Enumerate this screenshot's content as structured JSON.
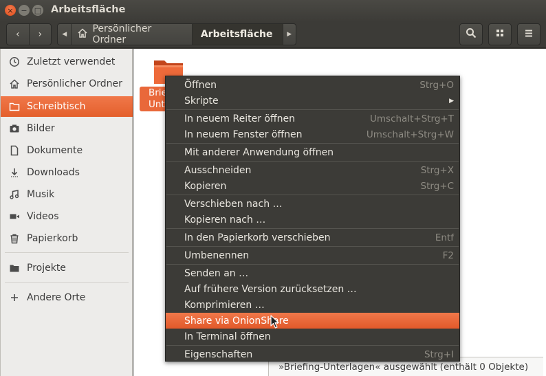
{
  "window": {
    "title": "Arbeitsfläche",
    "close_glyph": "×",
    "min_glyph": "−",
    "max_glyph": "□"
  },
  "toolbar": {
    "back_glyph": "‹",
    "forward_glyph": "›",
    "path_left_glyph": "◀",
    "path_right_glyph": "▶",
    "path": [
      {
        "label": "Persönlicher Ordner",
        "icon": "home-icon"
      },
      {
        "label": "Arbeitsfläche",
        "active": true
      }
    ]
  },
  "sidebar": {
    "items": [
      {
        "label": "Zuletzt verwendet",
        "icon": "clock-icon"
      },
      {
        "label": "Persönlicher Ordner",
        "icon": "home-icon"
      },
      {
        "label": "Schreibtisch",
        "icon": "folder-icon",
        "active": true
      },
      {
        "label": "Bilder",
        "icon": "camera-icon"
      },
      {
        "label": "Dokumente",
        "icon": "document-icon"
      },
      {
        "label": "Downloads",
        "icon": "download-icon"
      },
      {
        "label": "Musik",
        "icon": "music-icon"
      },
      {
        "label": "Videos",
        "icon": "video-icon"
      },
      {
        "label": "Papierkorb",
        "icon": "trash-icon"
      },
      {
        "label": "Projekte",
        "icon": "folder-icon"
      },
      {
        "label": "Andere Orte",
        "icon": "plus-icon"
      }
    ]
  },
  "main": {
    "file_label_line1": "Brief",
    "file_label_line2": "Unte",
    "status": "»Briefing-Unterlagen« ausgewählt  (enthält 0 Objekte)"
  },
  "context_menu": {
    "items": [
      {
        "label": "Öffnen",
        "accel": "Strg+O"
      },
      {
        "label": "Skripte",
        "submenu_glyph": "▶"
      },
      {
        "label": "In neuem Reiter öffnen",
        "accel": "Umschalt+Strg+T"
      },
      {
        "label": "In neuem Fenster öffnen",
        "accel": "Umschalt+Strg+W"
      },
      {
        "label": "Mit anderer Anwendung öffnen"
      },
      {
        "label": "Ausschneiden",
        "accel": "Strg+X"
      },
      {
        "label": "Kopieren",
        "accel": "Strg+C"
      },
      {
        "label": "Verschieben nach …"
      },
      {
        "label": "Kopieren nach …"
      },
      {
        "label": "In den Papierkorb verschieben",
        "accel": "Entf"
      },
      {
        "label": "Umbenennen",
        "accel": "F2"
      },
      {
        "label": "Senden an …"
      },
      {
        "label": "Auf frühere Version zurücksetzen …"
      },
      {
        "label": "Komprimieren …"
      },
      {
        "label": "Share via OnionShare",
        "highlighted": true
      },
      {
        "label": "In Terminal öffnen"
      },
      {
        "label": "Eigenschaften",
        "accel": "Strg+I"
      }
    ]
  },
  "colors": {
    "accent": "#e95420",
    "menu_bg": "#3c3b37",
    "sidebar_bg": "#edecea"
  }
}
